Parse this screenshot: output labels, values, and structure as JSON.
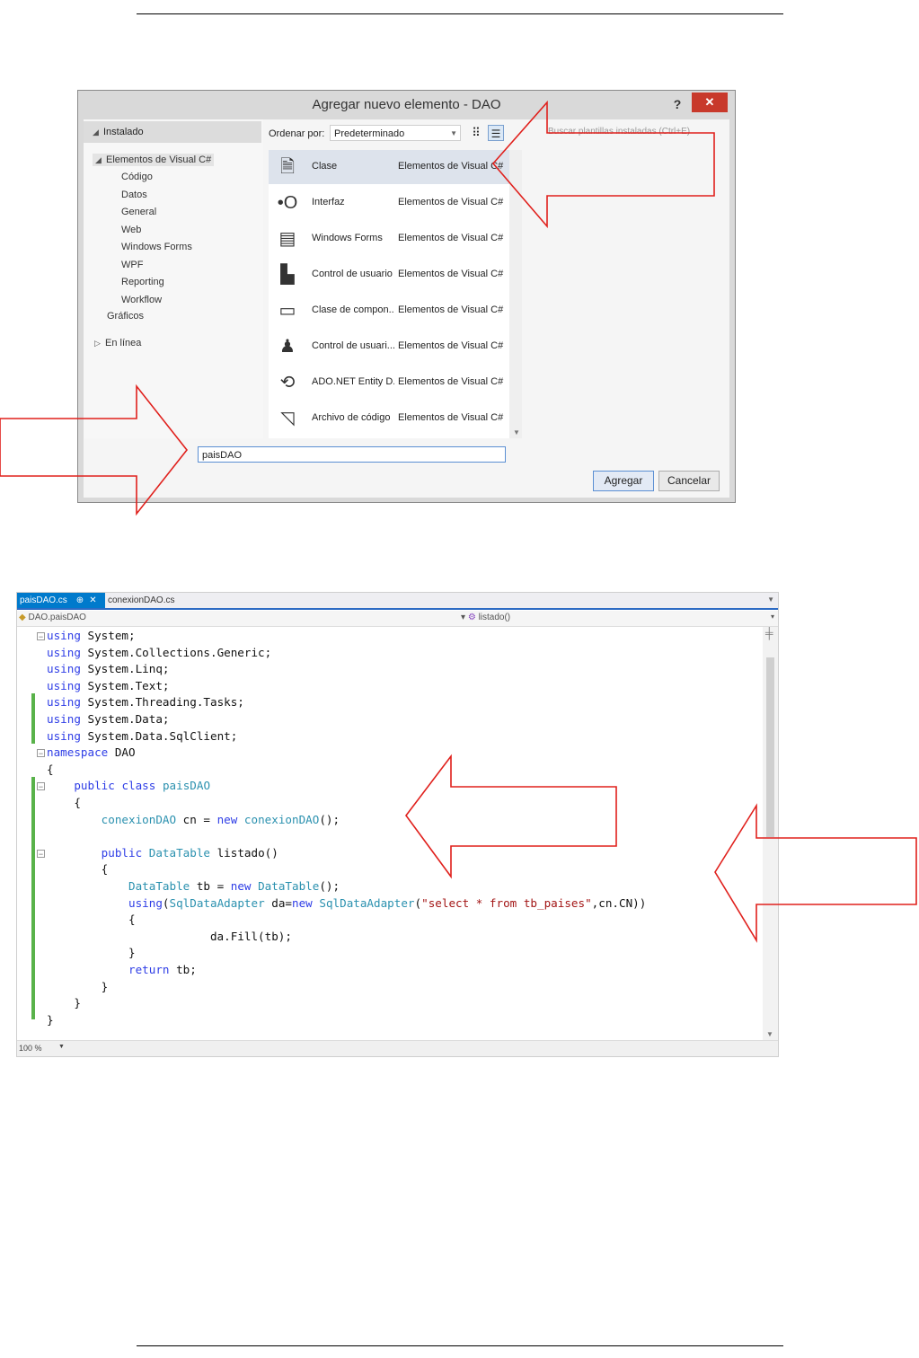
{
  "dialog": {
    "title": "Agregar nuevo elemento - DAO",
    "help": "?",
    "close": "✕",
    "tree": {
      "installed": "Instalado",
      "elementos": "Elementos de Visual C#",
      "children": [
        "Código",
        "Datos",
        "General",
        "Web",
        "Windows Forms",
        "WPF",
        "Reporting",
        "Workflow"
      ],
      "graficos": "Gráficos",
      "online": "En línea"
    },
    "sort_label": "Ordenar por:",
    "sort_value": "Predeterminado",
    "search_placeholder": "Buscar plantillas instaladas (Ctrl+E)",
    "items": [
      {
        "name": "Clase",
        "type": "Elementos de Visual C#",
        "icon": "class-icon",
        "glyph": "🗎"
      },
      {
        "name": "Interfaz",
        "type": "Elementos de Visual C#",
        "icon": "interface-icon",
        "glyph": "•O"
      },
      {
        "name": "Windows Forms",
        "type": "Elementos de Visual C#",
        "icon": "form-icon",
        "glyph": "▤"
      },
      {
        "name": "Control de usuario",
        "type": "Elementos de Visual C#",
        "icon": "user-control-icon",
        "glyph": "▙"
      },
      {
        "name": "Clase de compon...",
        "type": "Elementos de Visual C#",
        "icon": "component-class-icon",
        "glyph": "▭"
      },
      {
        "name": "Control de usuari...",
        "type": "Elementos de Visual C#",
        "icon": "user-control-wpf-icon",
        "glyph": "♟"
      },
      {
        "name": "ADO.NET Entity D...",
        "type": "Elementos de Visual C#",
        "icon": "entity-data-icon",
        "glyph": "⟲"
      },
      {
        "name": "Archivo de código",
        "type": "Elementos de Visual C#",
        "icon": "code-file-icon",
        "glyph": "◹"
      }
    ],
    "name_value": "paisDAO",
    "add_label": "Agregar",
    "cancel_label": "Cancelar"
  },
  "editor": {
    "tab_active": "paisDAO.cs",
    "tab_pin": "⊕",
    "tab_close": "✕",
    "tab_other": "conexionDAO.cs",
    "nav_class": "DAO.paisDAO",
    "nav_member": "listado()",
    "zoom": "100 %",
    "lines": [
      "<span class=\"kw\">using</span> System;",
      "<span class=\"kw\">using</span> System.Collections.Generic;",
      "<span class=\"kw\">using</span> System.Linq;",
      "<span class=\"kw\">using</span> System.Text;",
      "<span class=\"kw\">using</span> System.Threading.Tasks;",
      "<span class=\"kw\">using</span> System.Data;",
      "<span class=\"kw\">using</span> System.Data.SqlClient;",
      "<span class=\"kw\">namespace</span> DAO",
      "{",
      "    <span class=\"kw\">public</span> <span class=\"kw\">class</span> <span class=\"ty\">paisDAO</span>",
      "    {",
      "        <span class=\"ty\">conexionDAO</span> cn = <span class=\"kw\">new</span> <span class=\"ty\">conexionDAO</span>();",
      "",
      "        <span class=\"kw\">public</span> <span class=\"ty\">DataTable</span> listado()",
      "        {",
      "            <span class=\"ty\">DataTable</span> tb = <span class=\"kw\">new</span> <span class=\"ty\">DataTable</span>();",
      "            <span class=\"kw\">using</span>(<span class=\"ty\">SqlDataAdapter</span> da=<span class=\"kw\">new</span> <span class=\"ty\">SqlDataAdapter</span>(<span class=\"st\">\"select * from tb_paises\"</span>,cn.CN))",
      "            {",
      "                        da.Fill(tb);",
      "            }",
      "            <span class=\"kw\">return</span> tb;",
      "        }",
      "    }",
      "}"
    ]
  }
}
